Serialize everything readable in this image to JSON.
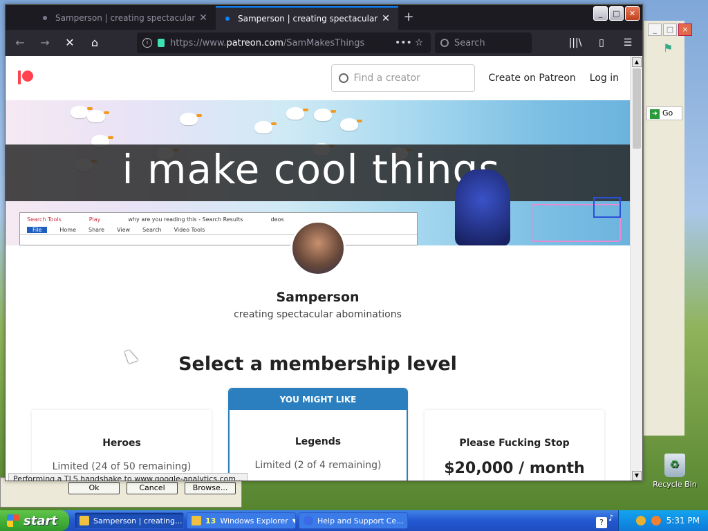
{
  "desktop": {
    "recycle_bin_label": "Recycle Bin",
    "bg_window": {
      "go_label": "Go"
    },
    "dialog_buttons": [
      "Ok",
      "Cancel",
      "Browse..."
    ]
  },
  "browser": {
    "tabs": [
      {
        "title": "Samperson | creating spectacular",
        "active": false
      },
      {
        "title": "Samperson | creating spectacular",
        "active": true
      }
    ],
    "url_prefix": "https://www.",
    "url_domain": "patreon.com",
    "url_path": "/SamMakesThings",
    "search_placeholder": "Search",
    "status_text": "Performing a TLS handshake to www.google-analytics.com..."
  },
  "patreon": {
    "find_placeholder": "Find a creator",
    "create_link": "Create on Patreon",
    "login_link": "Log in",
    "banner_text": "i make cool things",
    "banner_mini_window": {
      "tab_labels": [
        "Search Tools",
        "Play"
      ],
      "title": "why are you reading this - Search Results",
      "tail": "deos",
      "ribbon": [
        "File",
        "Home",
        "Share",
        "View",
        "Search",
        "Video Tools"
      ]
    },
    "creator_name": "Samperson",
    "creator_tagline": "creating spectacular abominations",
    "section_title": "Select a membership level",
    "tiers": [
      {
        "name": "Heroes",
        "limit": "Limited (24 of 50 remaining)",
        "price": ""
      },
      {
        "name": "Legends",
        "limit": "Limited (2 of 4 remaining)",
        "price": "",
        "ribbon": "YOU MIGHT LIKE"
      },
      {
        "name": "Please Fucking Stop",
        "limit": "",
        "price": "$20,000 / month"
      }
    ]
  },
  "taskbar": {
    "start_label": "start",
    "items": [
      {
        "label": "Samperson | creating...",
        "active": true
      },
      {
        "label": "Windows Explorer",
        "count": "13",
        "active": false
      },
      {
        "label": "Help and Support Ce...",
        "active": false
      }
    ],
    "clock": "5:31 PM"
  }
}
